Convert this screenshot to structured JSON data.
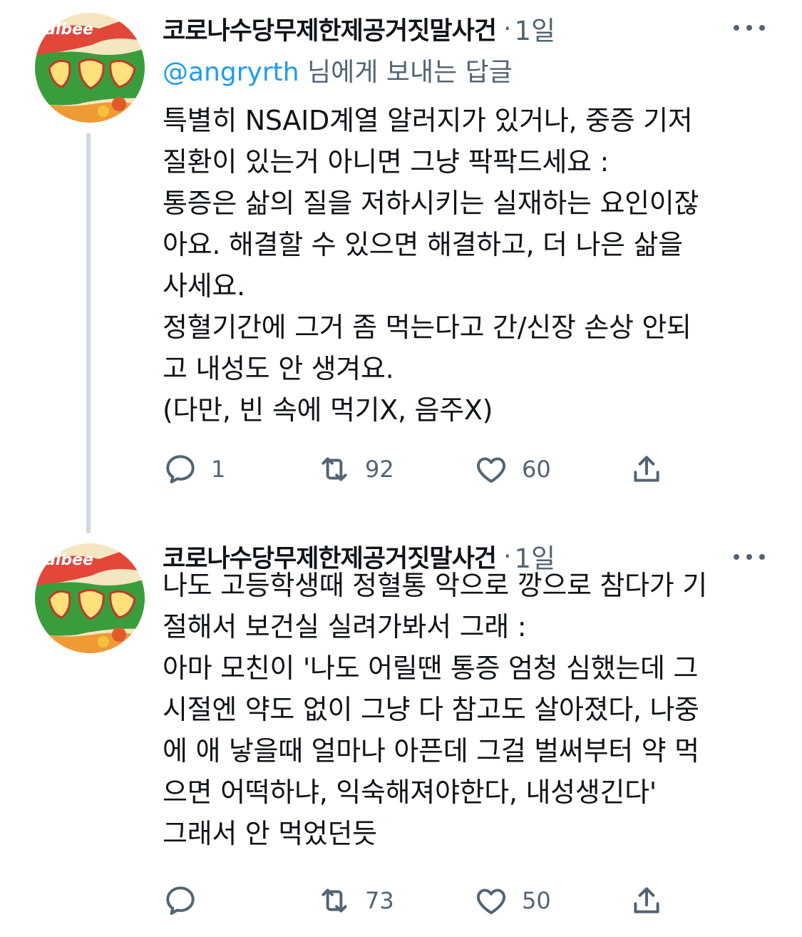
{
  "tweets": [
    {
      "author": {
        "display_name": "코로나수당무제한제공거짓말사건",
        "avatar_text": "albee"
      },
      "separator": "·",
      "time": "1일",
      "reply_to": {
        "handle": "@angryrth",
        "suffix": " 님에게 보내는 답글"
      },
      "text_lines": [
        "특별히 NSAID계열 알러지가 있거나, 중증 기저",
        "질환이 있는거 아니면 그냥 팍팍드세요 :",
        "통증은 삶의 질을 저하시키는 실재하는 요인이잖",
        "아요. 해결할 수 있으면 해결하고, 더 나은 삶을",
        "사세요.",
        "정혈기간에 그거 좀 먹는다고 간/신장 손상 안되",
        "고 내성도 안 생겨요.",
        "(다만, 빈 속에 먹기X, 음주X)"
      ],
      "stats": {
        "replies": "1",
        "retweets": "92",
        "likes": "60"
      }
    },
    {
      "author": {
        "display_name": "코로나수당무제한제공거짓말사건",
        "avatar_text": "albee"
      },
      "separator": "·",
      "time": "1일",
      "text_lines": [
        "나도 고등학생때 정혈통 악으로 깡으로 참다가 기",
        "절해서 보건실 실려가봐서 그래 :",
        "아마 모친이 '나도 어릴땐 통증 엄청 심했는데 그",
        "시절엔 약도 없이 그냥 다 참고도 살아졌다, 나중",
        "에 애 낳을때 얼마나 아픈데 그걸 벌써부터 약 먹",
        "으면 어떡하냐, 익숙해져야한다, 내성생긴다'",
        "그래서 안 먹었던듯"
      ],
      "stats": {
        "replies": "",
        "retweets": "73",
        "likes": "50"
      }
    }
  ],
  "colors": {
    "text": "#0f1419",
    "secondary": "#536471",
    "link": "#1d9bf0",
    "thread_line": "#cfd9de",
    "avatar_green": "#2f9a3a",
    "avatar_red": "#d8262d"
  },
  "icons": [
    "more-icon",
    "reply-icon",
    "retweet-icon",
    "like-icon",
    "share-icon"
  ]
}
